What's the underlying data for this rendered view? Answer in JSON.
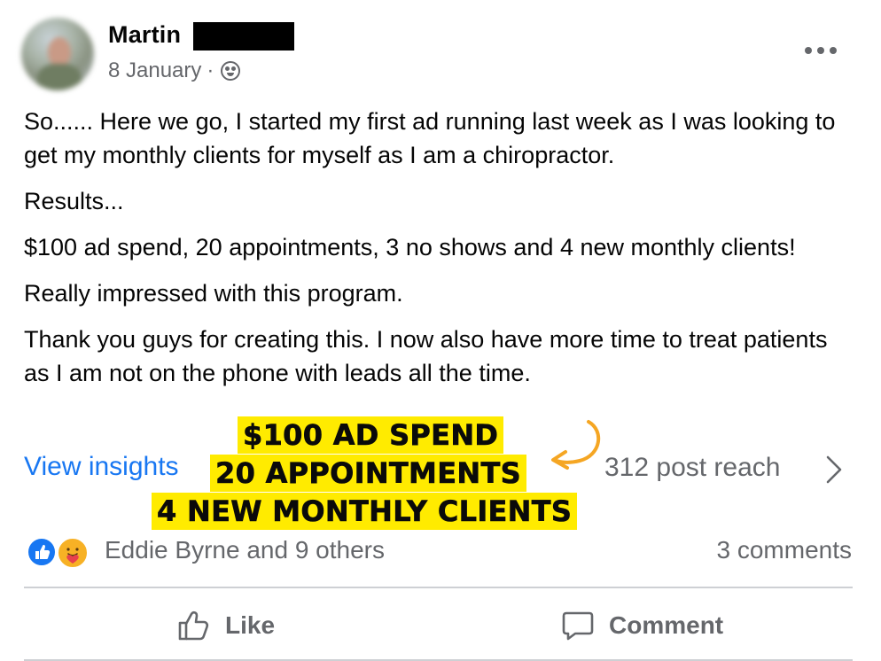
{
  "post": {
    "author": "Martin",
    "date": "8 January",
    "separator": "·",
    "paragraphs": [
      "So...... Here we go, I started my first ad running last week as I was looking to get my monthly clients for myself as I am a chiropractor.",
      "Results...",
      "$100 ad spend, 20 appointments, 3 no shows and 4 new monthly clients!",
      "Really impressed with this program.",
      "Thank you guys for creating this. I now also have more time to treat patients as I am not on the phone with leads all the time."
    ]
  },
  "insights": {
    "link_label": "View insights",
    "reach": "312 post reach"
  },
  "highlights": [
    "$100 AD SPEND",
    "20 APPOINTMENTS",
    "4 NEW MONTHLY CLIENTS"
  ],
  "reactions": {
    "names": "Eddie Byrne and 9 others",
    "comments": "3 comments"
  },
  "actions": {
    "like": "Like",
    "comment": "Comment"
  },
  "colors": {
    "link_blue": "#1877f2",
    "secondary_text": "#65676b",
    "highlight": "#ffeb00",
    "arrow": "#f5a623"
  },
  "icons": [
    "privacy-globe-icon",
    "more-options-icon",
    "chevron-right-icon",
    "like-reaction-icon",
    "care-reaction-icon",
    "thumbs-up-icon",
    "comment-bubble-icon",
    "curved-arrow-icon"
  ]
}
